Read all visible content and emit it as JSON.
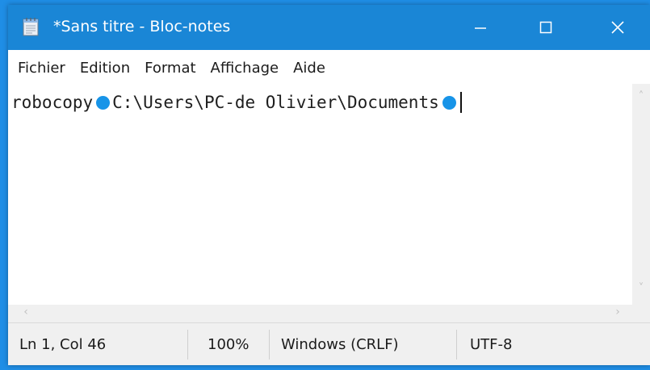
{
  "window": {
    "title": "*Sans titre - Bloc-notes",
    "accent_color": "#1a86d6",
    "controls": {
      "minimize_icon": "minimize-icon",
      "maximize_icon": "maximize-icon",
      "close_icon": "close-icon"
    }
  },
  "menu": {
    "items": [
      "Fichier",
      "Edition",
      "Format",
      "Affichage",
      "Aide"
    ]
  },
  "editor": {
    "segments": [
      "robocopy",
      "C:\\Users\\PC-de Olivier\\Documents"
    ],
    "space_marker_color": "#1794e8"
  },
  "statusbar": {
    "position": "Ln 1, Col 46",
    "zoom": "100%",
    "line_ending": "Windows (CRLF)",
    "encoding": "UTF-8"
  }
}
